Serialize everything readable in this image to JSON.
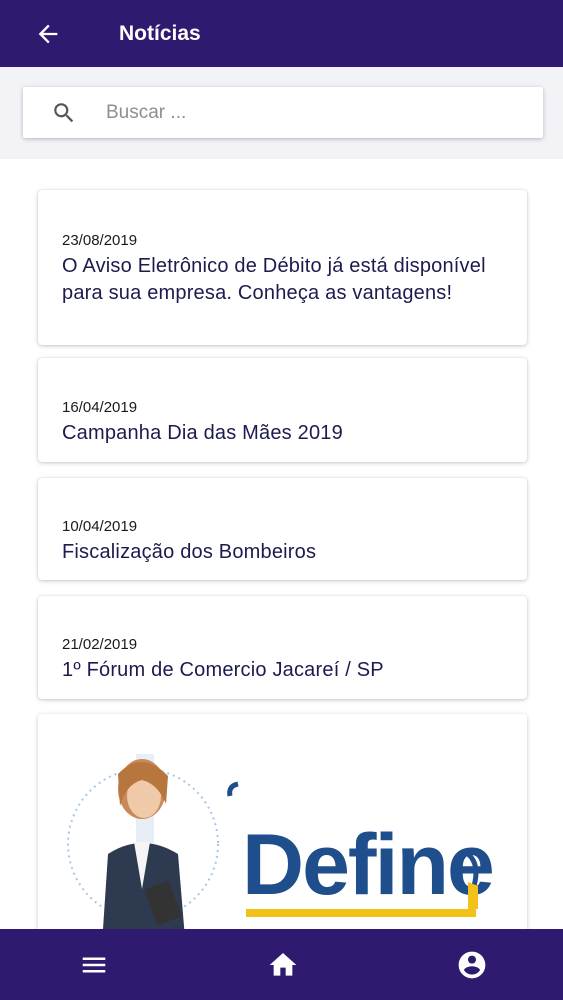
{
  "header": {
    "title": "Notícias",
    "back_icon": "arrow-left-icon",
    "background": "#2e1a6e"
  },
  "search": {
    "placeholder": "Buscar ...",
    "value": "",
    "icon": "search-icon"
  },
  "news": [
    {
      "date": "23/08/2019",
      "title": "O Aviso Eletrônico de Débito já está disponível para sua empresa. Conheça as vantagens!"
    },
    {
      "date": "16/04/2019",
      "title": "Campanha Dia das Mães 2019"
    },
    {
      "date": "10/04/2019",
      "title": "Fiscalização dos Bombeiros"
    },
    {
      "date": "21/02/2019",
      "title": "1º Fórum de Comercio Jacareí / SP"
    }
  ],
  "banner": {
    "logo_text": "Define",
    "logo_color": "#1f4e8c",
    "accent_color": "#f2c21b"
  },
  "bottom_nav": {
    "items": [
      {
        "icon": "menu-icon"
      },
      {
        "icon": "home-icon"
      },
      {
        "icon": "account-circle-icon"
      }
    ]
  }
}
